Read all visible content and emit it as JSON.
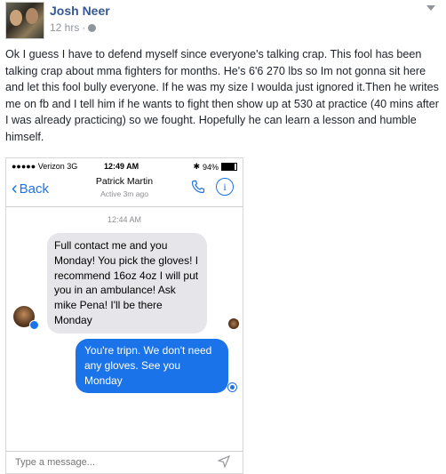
{
  "post": {
    "author": "Josh Neer",
    "time": "12 hrs",
    "separator": "·",
    "body": "Ok I guess I have to defend myself since everyone's talking crap. This fool has been talking crap about mma fighters for months. He's 6'6 270 lbs so Im not gonna sit here and let this fool bully everyone. If he was my size I woulda just ignored it.Then he writes me on fb and I tell him if he wants to fight then show up at 530 at practice (40 mins after I was already practicing) so we fought. Hopefully he can learn a lesson and humble himself."
  },
  "screenshot": {
    "status": {
      "carrier": "Verizon",
      "network": "3G",
      "time": "12:49 AM",
      "battery": "94%",
      "bluetooth": "✱",
      "signal": "●●●●●"
    },
    "nav": {
      "back_label": "Back",
      "contact_name": "Patrick Martin",
      "contact_status": "Active 3m ago"
    },
    "timestamp": "12:44 AM",
    "messages": [
      {
        "direction": "in",
        "text": "Full contact me and you Monday! You pick the gloves! I recommend 16oz 4oz I will put you in an ambulance! Ask mike Pena! I'll be there Monday"
      },
      {
        "direction": "out",
        "text": "You're tripn. We don't need any gloves. See you Monday"
      }
    ],
    "compose_placeholder": "Type a message..."
  },
  "icons": {
    "privacy": "globe-icon",
    "menu": "chevron-down-icon",
    "phone": "phone-icon",
    "info": "info-icon",
    "send": "send-icon"
  },
  "colors": {
    "link": "#365899",
    "messenger_blue": "#1a73e8",
    "bubble_gray": "#e5e5ea"
  }
}
